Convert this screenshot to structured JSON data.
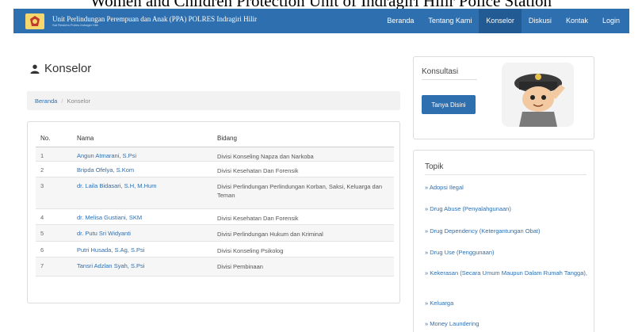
{
  "caption": "Women and Children Protection Unit of Indragiri Hilir Police Station",
  "navbar": {
    "brand_title": "Unit Perlindungan Perempuan dan Anak (PPA) POLRES Indragiri Hilir",
    "brand_subtitle": "Sat Reskrim Polres Indragiri Hilir",
    "links": [
      "Beranda",
      "Tentang Kami",
      "Konselor",
      "Diskusi",
      "Kontak",
      "Login"
    ],
    "active": "Konselor"
  },
  "page": {
    "title": "Konselor",
    "breadcrumb": {
      "home": "Beranda",
      "separator": "/",
      "current": "Konselor"
    }
  },
  "table": {
    "headers": {
      "no": "No.",
      "nama": "Nama",
      "bidang": "Bidang"
    },
    "rows": [
      {
        "no": "1",
        "nama": "Angun Atmarani, S.Psi",
        "bidang": "Divisi Konseling Napza dan Narkoba"
      },
      {
        "no": "2",
        "nama": "Bripda Ofelya, S.Kom",
        "bidang": "Divisi Kesehatan Dan Forensik"
      },
      {
        "no": "3",
        "nama": "dr. Laila Bidasari, S.H, M.Hum",
        "bidang": "Divisi Perlindungan Perlindungan Korban, Saksi, Keluarga dan Teman"
      },
      {
        "no": "4",
        "nama": "dr. Melisa Gustiani, SKM",
        "bidang": "Divisi Kesehatan Dan Forensik"
      },
      {
        "no": "5",
        "nama": "dr. Putu Sri Widyanti",
        "bidang": "Divisi Perlindungan Hukum dan Kriminal"
      },
      {
        "no": "6",
        "nama": "Putri Husada, S.Ag, S.Psi",
        "bidang": "Divisi Konseling Psikolog"
      },
      {
        "no": "7",
        "nama": "Tansri Adzlan Syah, S.Psi",
        "bidang": "Divisi Pembinaan"
      }
    ]
  },
  "konsultasi": {
    "title": "Konsultasi",
    "button_label": "Tanya Disini"
  },
  "topik": {
    "title": "Topik",
    "items": [
      "» Adopsi Ilegal",
      "» Drug Abuse (Penyalahgunaan)",
      "» Drug Dependency (Ketergantungan Obat)",
      "» Drug Use (Penggunaan)",
      "» Kekerasan (Secara Umum Maupun Dalam Rumah Tangga),",
      "» Keluarga",
      "» Money Laundering"
    ]
  },
  "colors": {
    "navbar": "#2e6fb0",
    "navbar_active": "#225a93",
    "link": "#2e6fb0",
    "button": "#2e6fb0"
  }
}
